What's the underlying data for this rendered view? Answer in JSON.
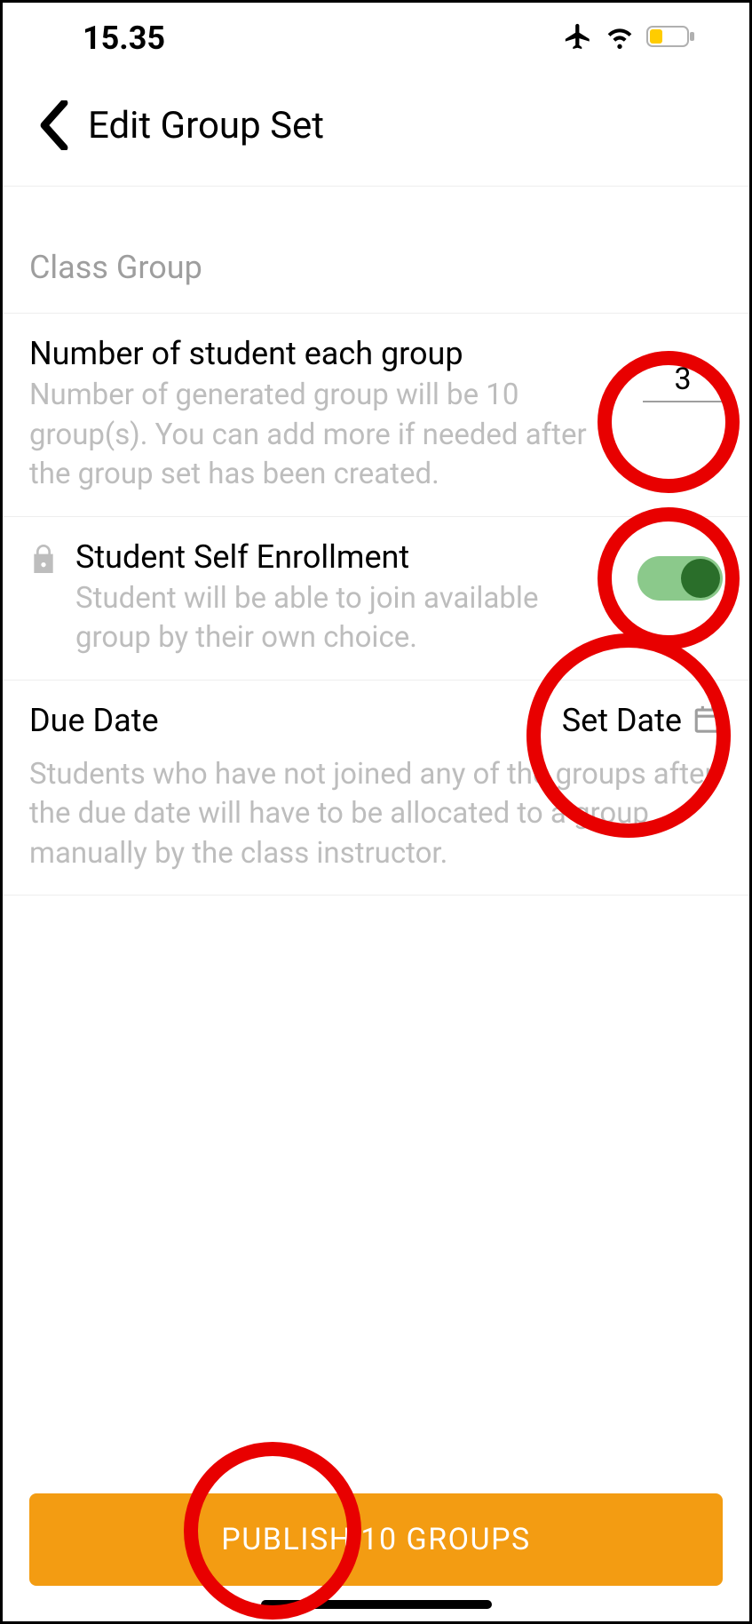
{
  "status_bar": {
    "time": "15.35"
  },
  "header": {
    "title": "Edit Group Set"
  },
  "section_label": "Class Group",
  "group_size_row": {
    "title": "Number of student each group",
    "desc": "Number of generated group will be 10 group(s). You can add more if needed after the group set has been created.",
    "value": "3"
  },
  "self_enroll_row": {
    "title": "Student Self Enrollment",
    "desc": "Student will be able to join available group by their own choice.",
    "toggle": true
  },
  "due_date_row": {
    "title": "Due Date",
    "action_label": "Set Date",
    "desc": "Students who have not joined any of the groups after the due date will have to be allocated to a group manually by the class instructor."
  },
  "publish_button": {
    "label": "PUBLISH 10 GROUPS"
  }
}
